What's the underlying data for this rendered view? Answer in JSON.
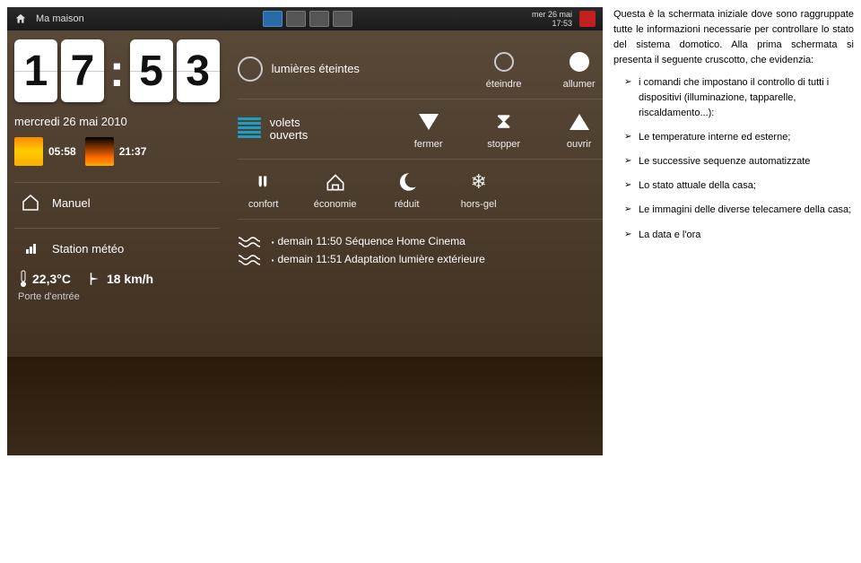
{
  "topbar": {
    "home_icon": "home-icon",
    "title": "Ma maison",
    "day": "mer 26 mai",
    "time": "17:53"
  },
  "clock": {
    "h1": "1",
    "h2": "7",
    "m1": "5",
    "m2": "3"
  },
  "date_line": "mercredi 26 mai 2010",
  "sun": {
    "rise": "05:58",
    "set": "21:37"
  },
  "mode": {
    "icon": "house-outline-icon",
    "label": "Manuel"
  },
  "weather": {
    "heading_icon": "signal-icon",
    "heading": "Station météo",
    "temp": "22,3°C",
    "wind": "18 km/h",
    "location": "Porte d'entrée"
  },
  "controls": {
    "lights": {
      "status": "lumières éteintes",
      "off": "éteindre",
      "on": "allumer"
    },
    "shutters": {
      "status_l1": "volets",
      "status_l2": "ouverts",
      "close": "fermer",
      "stop": "stopper",
      "open": "ouvrir"
    },
    "heating": {
      "comfort": "confort",
      "economy": "économie",
      "reduced": "réduit",
      "frost": "hors-gel"
    }
  },
  "sequences": {
    "item1": "demain 11:50  Séquence Home Cinema",
    "item2": "demain 11:51  Adaptation lumière extérieure"
  },
  "description": {
    "p1": "Questa è la schermata iniziale dove sono raggruppate tutte le informazioni necessarie per controllare lo stato del sistema domotico. Alla prima schermata si presenta il seguente cruscotto, che evidenzia:",
    "b1": "i comandi che impostano il controllo di tutti i dispositivi (illuminazione, tapparelle, riscaldamento...):",
    "b2": "Le temperature interne ed esterne;",
    "b3": "Le successive sequenze automatizzate",
    "b4": "Lo stato attuale della casa;",
    "b5": "Le immagini delle diverse telecamere della casa;",
    "b6": "La data e l'ora"
  }
}
